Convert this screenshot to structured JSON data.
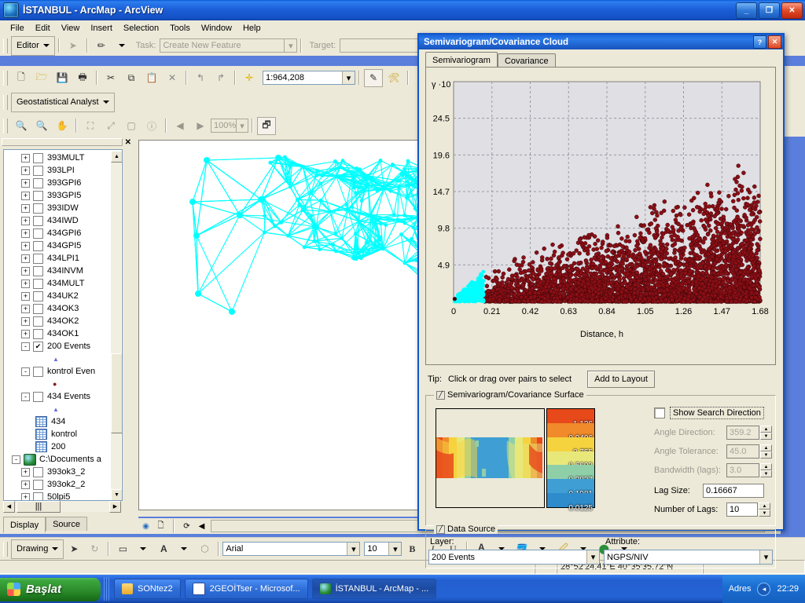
{
  "window": {
    "title": "İSTANBUL - ArcMap - ArcView",
    "minimize": "_",
    "maximize": "❐",
    "close": "✕"
  },
  "menu": [
    "File",
    "Edit",
    "View",
    "Insert",
    "Selection",
    "Tools",
    "Window",
    "Help"
  ],
  "editor_toolbar": {
    "editor_label": "Editor",
    "task_label": "Task:",
    "task_value": "Create New Feature",
    "target_label": "Target:",
    "target_value": ""
  },
  "standard_toolbar": {
    "scale_value": "1:964,208",
    "icons": [
      "new-document-icon",
      "open-folder-icon",
      "save-icon",
      "print-icon",
      "cut-icon",
      "copy-icon",
      "paste-icon",
      "delete-icon",
      "undo-icon",
      "redo-icon",
      "add-data-icon"
    ],
    "right_icons": [
      "editor-toolbar-icon",
      "toolbox-icon",
      "whats-this-icon"
    ]
  },
  "geostat_toolbar": {
    "label": "Geostatistical Analyst",
    "zoom_value": "100%",
    "icons": [
      "zoom-in-icon",
      "zoom-out-icon",
      "pan-icon",
      "full-extent-icon",
      "zoom-layer-icon",
      "select-icon",
      "identify-icon",
      "back-extent-icon",
      "forward-extent-icon",
      "refresh-icon"
    ]
  },
  "toc": {
    "close_label": "✕",
    "items": [
      {
        "label": "393MULT",
        "expander": "+",
        "checked": false,
        "type": "layer"
      },
      {
        "label": "393LPI",
        "expander": "+",
        "checked": false,
        "type": "layer"
      },
      {
        "label": "393GPI6",
        "expander": "+",
        "checked": false,
        "type": "layer"
      },
      {
        "label": "393GPI5",
        "expander": "+",
        "checked": false,
        "type": "layer"
      },
      {
        "label": "393IDW",
        "expander": "+",
        "checked": false,
        "type": "layer"
      },
      {
        "label": "434IWD",
        "expander": "+",
        "checked": false,
        "type": "layer"
      },
      {
        "label": "434GPI6",
        "expander": "+",
        "checked": false,
        "type": "layer"
      },
      {
        "label": "434GPI5",
        "expander": "+",
        "checked": false,
        "type": "layer"
      },
      {
        "label": "434LPI1",
        "expander": "+",
        "checked": false,
        "type": "layer"
      },
      {
        "label": "434INVM",
        "expander": "+",
        "checked": false,
        "type": "layer"
      },
      {
        "label": "434MULT",
        "expander": "+",
        "checked": false,
        "type": "layer"
      },
      {
        "label": "434UK2",
        "expander": "+",
        "checked": false,
        "type": "layer"
      },
      {
        "label": "434OK3",
        "expander": "+",
        "checked": false,
        "type": "layer"
      },
      {
        "label": "434OK2",
        "expander": "+",
        "checked": false,
        "type": "layer"
      },
      {
        "label": "434OK1",
        "expander": "+",
        "checked": false,
        "type": "layer"
      },
      {
        "label": "200 Events",
        "expander": "-",
        "checked": true,
        "type": "layer"
      },
      {
        "label": "",
        "type": "symbol-triangle"
      },
      {
        "label": "kontrol Even",
        "expander": "-",
        "checked": false,
        "type": "layer"
      },
      {
        "label": "",
        "type": "symbol-dot"
      },
      {
        "label": "434 Events",
        "expander": "-",
        "checked": false,
        "type": "layer"
      },
      {
        "label": "",
        "type": "symbol-triangle"
      },
      {
        "label": "434",
        "type": "table"
      },
      {
        "label": "kontrol",
        "type": "table"
      },
      {
        "label": "200",
        "type": "table"
      },
      {
        "label": "C:\\Documents a",
        "expander": "-",
        "type": "folder"
      },
      {
        "label": "393ok3_2",
        "expander": "+",
        "checked": false,
        "type": "layer"
      },
      {
        "label": "393ok2_2",
        "expander": "+",
        "checked": false,
        "type": "layer"
      },
      {
        "label": "50lpi5",
        "expander": "+",
        "checked": false,
        "type": "layer"
      }
    ],
    "tabs": [
      {
        "label": "Display",
        "active": true
      },
      {
        "label": "Source",
        "active": false
      }
    ]
  },
  "drawing_toolbar": {
    "label": "Drawing",
    "font_name": "Arial",
    "font_size": "10",
    "bold": "B",
    "italic": "I",
    "underline": "U"
  },
  "statusbar": {
    "coordinates": "28°52'24.41\"E  40°35'35.72\"N"
  },
  "taskbar": {
    "start_label": "Başlat",
    "tasks": [
      {
        "label": "SONtez2",
        "icon": "folder-icon",
        "active": false
      },
      {
        "label": "2GEOİTser - Microsof...",
        "icon": "word-document-icon",
        "active": false
      },
      {
        "label": "İSTANBUL - ArcMap - ...",
        "icon": "arcmap-icon",
        "active": true
      }
    ],
    "tray_label": "Adres",
    "clock": "22:29"
  },
  "dialog": {
    "title": "Semivariogram/Covariance Cloud",
    "help_btn": "?",
    "close_btn": "✕",
    "tabs": [
      {
        "label": "Semivariogram",
        "active": true
      },
      {
        "label": "Covariance",
        "active": false
      }
    ],
    "tip_label": "Tip:",
    "tip_text": "Click or drag over pairs to select",
    "add_to_layout": "Add to Layout",
    "surface_group": "Semivariogram/Covariance Surface",
    "legend_values": [
      "1.126",
      "0.9406",
      "0.755",
      "0.5693",
      "0.3837",
      "0.1981",
      "0.0125"
    ],
    "legend_colors": [
      "#e8491b",
      "#f08a2a",
      "#f5d33f",
      "#e8e87a",
      "#8fcfa8",
      "#3f9fd4",
      "#2f8ccc"
    ],
    "show_search_direction": {
      "label": "Show Search Direction",
      "checked": false
    },
    "angle_direction": {
      "label": "Angle Direction:",
      "value": "359.2",
      "enabled": false
    },
    "angle_tolerance": {
      "label": "Angle Tolerance:",
      "value": "45.0",
      "enabled": false
    },
    "bandwidth": {
      "label": "Bandwidth (lags):",
      "value": "3.0",
      "enabled": false
    },
    "lag_size": {
      "label": "Lag Size:",
      "value": "0.16667",
      "enabled": true
    },
    "number_of_lags": {
      "label": "Number of Lags:",
      "value": "10",
      "enabled": true
    },
    "data_source_group": "Data Source",
    "layer_label": "Layer:",
    "layer_value": "200 Events",
    "attribute_label": "Attribute:",
    "attribute_value": "NGPS/NIV"
  },
  "chart_data": {
    "type": "scatter",
    "title": "",
    "xlabel": "Distance, h",
    "ylabel": "γ ·10",
    "xlim": [
      0,
      1.68
    ],
    "ylim": [
      0,
      29.4
    ],
    "xticks": [
      "0",
      "0.21",
      "0.42",
      "0.63",
      "0.84",
      "1.05",
      "1.26",
      "1.47",
      "1.68"
    ],
    "xtick_values": [
      0,
      0.21,
      0.42,
      0.63,
      0.84,
      1.05,
      1.26,
      1.47,
      1.68
    ],
    "yticks": [
      "4.9",
      "9.8",
      "14.7",
      "19.6",
      "24.5"
    ],
    "ytick_values": [
      4.9,
      9.8,
      14.7,
      19.6,
      24.5
    ],
    "grid": true,
    "point_color": "#8b0f16",
    "selected_color": "#00ffff",
    "background": "#dfdfe4",
    "n_points": 3800,
    "selected_n_points": 260,
    "selection_x_max": 0.165,
    "description": "Semivariogram cloud: gamma times 10 versus lag distance h; point cloud spreads upward with increasing distance, cyan points are the selected pairs at short lag distances near the origin",
    "series": [
      {
        "name": "all-pairs",
        "color": "#8b0f16"
      },
      {
        "name": "selected-pairs",
        "color": "#00ffff"
      }
    ]
  }
}
